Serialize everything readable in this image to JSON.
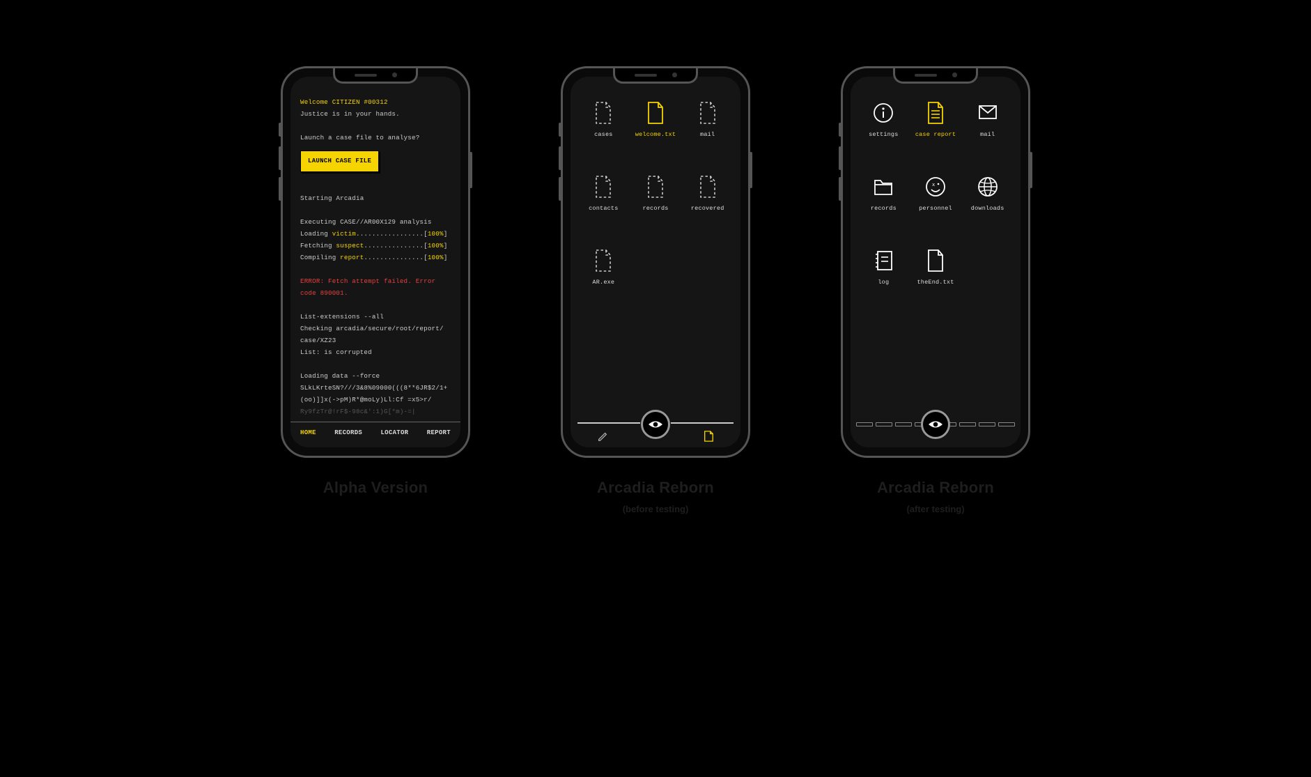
{
  "phone1": {
    "caption_title": "Alpha Version",
    "welcome": "Welcome CITIZEN #00312",
    "tagline": "Justice is in your hands.",
    "prompt": "Launch a case file to analyse?",
    "launch_button": "LAUNCH CASE FILE",
    "starting": "Starting Arcadia",
    "exec_line": "Executing CASE//AR00X129 analysis",
    "load_prefix": "Loading ",
    "load_word": "victim",
    "load_dots": ".................[",
    "load_pct": "100%",
    "load_close": "]",
    "fetch_prefix": "Fetching ",
    "fetch_word": "suspect",
    "fetch_dots": "...............[",
    "comp_prefix": "Compiling ",
    "comp_word": "report",
    "comp_dots": "...............[",
    "error_l1": "ERROR: Fetch attempt failed. Error",
    "error_l2": "code 890001.",
    "ext_l1": "List-extensions --all",
    "ext_l2": "Checking arcadia/secure/root/report/",
    "ext_l3": "case/XZ23",
    "ext_l4": "List: is corrupted",
    "force_l1": "Loading data --force",
    "force_l2": "SLkLKrteSN?///3&8%09000(((8**6JR$2/1+",
    "force_l3": "(oo)]]x(->pM)R*@moLy)Ll:Cf =x5>r/",
    "force_l4": "Ry9fzTr@!rF$-98c&':1)G[*m)-=|",
    "nav": {
      "home": "HOME",
      "records": "RECORDS",
      "locator": "LOCATOR",
      "report": "REPORT"
    }
  },
  "phone2": {
    "caption_title": "Arcadia Reborn",
    "caption_sub": "(before testing)",
    "items": [
      {
        "label": "cases"
      },
      {
        "label": "welcome.txt"
      },
      {
        "label": "mail"
      },
      {
        "label": "contacts"
      },
      {
        "label": "records"
      },
      {
        "label": "recovered"
      },
      {
        "label": "AR.exe"
      }
    ]
  },
  "phone3": {
    "caption_title": "Arcadia Reborn",
    "caption_sub": "(after testing)",
    "items": [
      {
        "label": "settings"
      },
      {
        "label": "case report"
      },
      {
        "label": "mail"
      },
      {
        "label": "records"
      },
      {
        "label": "personnel"
      },
      {
        "label": "downloads"
      },
      {
        "label": "log"
      },
      {
        "label": "theEnd.txt"
      }
    ]
  }
}
